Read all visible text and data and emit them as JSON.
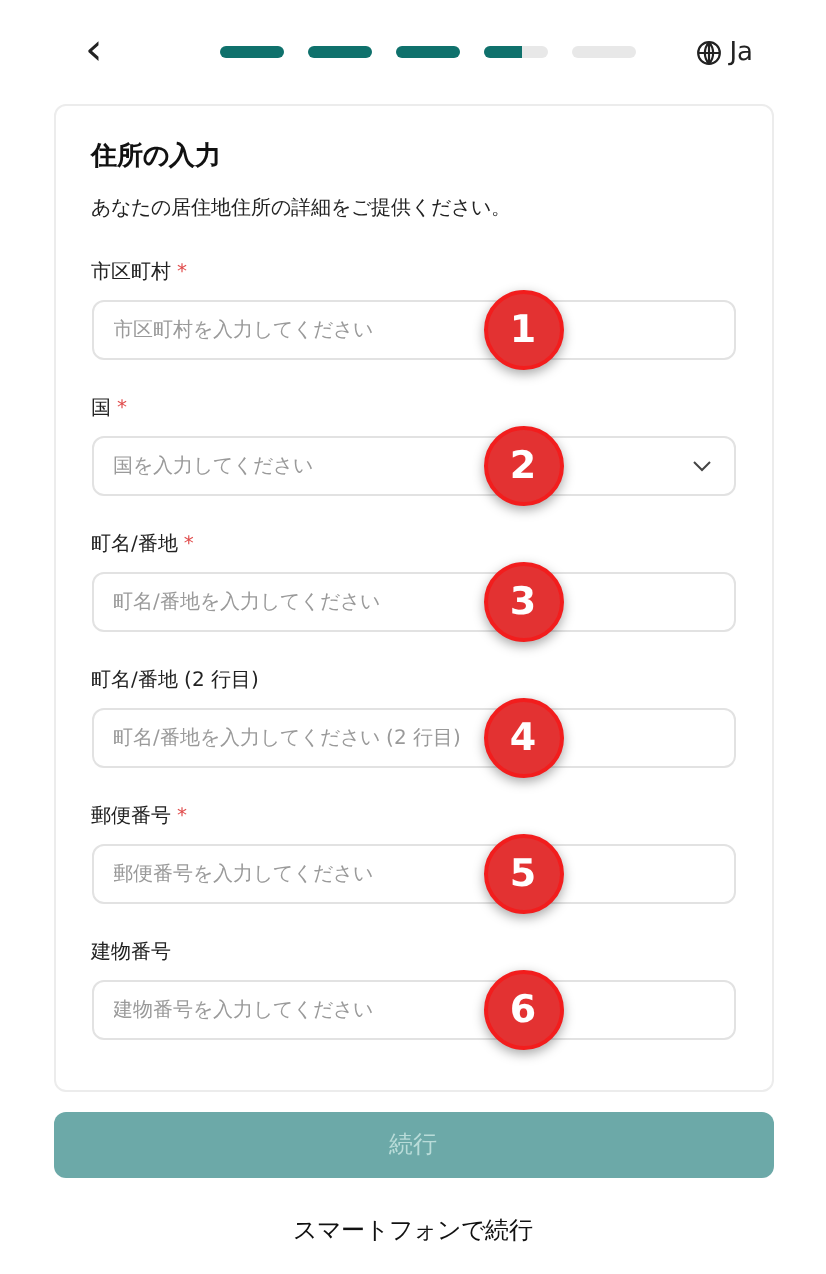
{
  "header": {
    "back": "‹",
    "steps": [
      {
        "level": 1
      },
      {
        "level": 1
      },
      {
        "level": 1
      },
      {
        "level": 0.6
      },
      {
        "level": 0
      }
    ],
    "language": "Ja"
  },
  "form": {
    "title": "住所の入力",
    "description": "あなたの居住地住所の詳細をご提供ください。",
    "fields": [
      {
        "kind": "text",
        "label": "市区町村",
        "asterisk": "*",
        "placeholder": "市区町村を入力してください",
        "marker": "1"
      },
      {
        "kind": "select",
        "label": "国",
        "asterisk": "*",
        "placeholder": "国を入力してください",
        "marker": "2"
      },
      {
        "kind": "text",
        "label": "町名/番地",
        "asterisk": "*",
        "placeholder": "町名/番地を入力してください",
        "marker": "3"
      },
      {
        "kind": "text",
        "label": "町名/番地 (2 行目)",
        "placeholder": "町名/番地を入力してください (2 行目)",
        "marker": "4"
      },
      {
        "kind": "text",
        "label": "郵便番号",
        "asterisk": "*",
        "placeholder": "郵便番号を入力してください",
        "marker": "5"
      },
      {
        "kind": "text",
        "label": "建物番号",
        "placeholder": "建物番号を入力してください",
        "marker": "6"
      }
    ]
  },
  "continue_button": {
    "label": "続行",
    "disabled": true
  },
  "smartphone_link": "スマートフォンで続行"
}
